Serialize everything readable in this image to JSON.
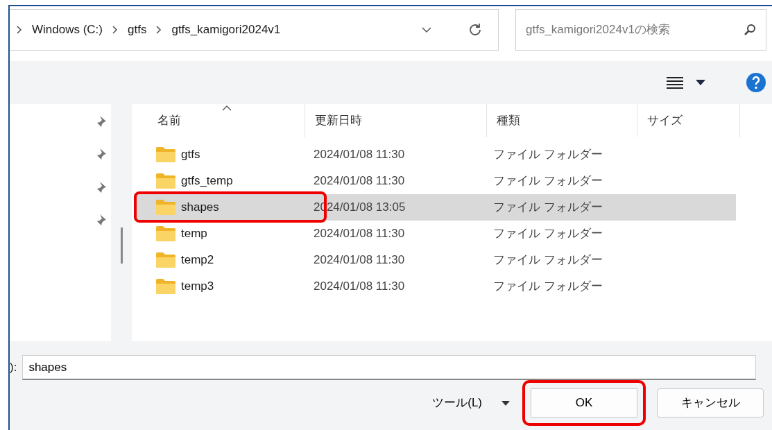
{
  "address_bar": {
    "crumbs": [
      "Windows (C:)",
      "gtfs",
      "gtfs_kamigori2024v1"
    ]
  },
  "search": {
    "placeholder": "gtfs_kamigori2024v1の検索"
  },
  "table": {
    "columns": [
      "名前",
      "更新日時",
      "種類",
      "サイズ"
    ],
    "rows": [
      {
        "name": "gtfs",
        "modified": "2024/01/08 11:30",
        "type": "ファイル フォルダー",
        "selected": false,
        "highlighted": false
      },
      {
        "name": "gtfs_temp",
        "modified": "2024/01/08 11:30",
        "type": "ファイル フォルダー",
        "selected": false,
        "highlighted": false
      },
      {
        "name": "shapes",
        "modified": "2024/01/08 13:05",
        "type": "ファイル フォルダー",
        "selected": true,
        "highlighted": true
      },
      {
        "name": "temp",
        "modified": "2024/01/08 11:30",
        "type": "ファイル フォルダー",
        "selected": false,
        "highlighted": false
      },
      {
        "name": "temp2",
        "modified": "2024/01/08 11:30",
        "type": "ファイル フォルダー",
        "selected": false,
        "highlighted": false
      },
      {
        "name": "temp3",
        "modified": "2024/01/08 11:30",
        "type": "ファイル フォルダー",
        "selected": false,
        "highlighted": false
      }
    ]
  },
  "filename": {
    "label": "):",
    "value": "shapes"
  },
  "footer": {
    "tools": "ツール(L)",
    "buttons": [
      {
        "label": "OK",
        "highlighted": true
      },
      {
        "label": "キャンセル",
        "highlighted": false
      }
    ]
  }
}
